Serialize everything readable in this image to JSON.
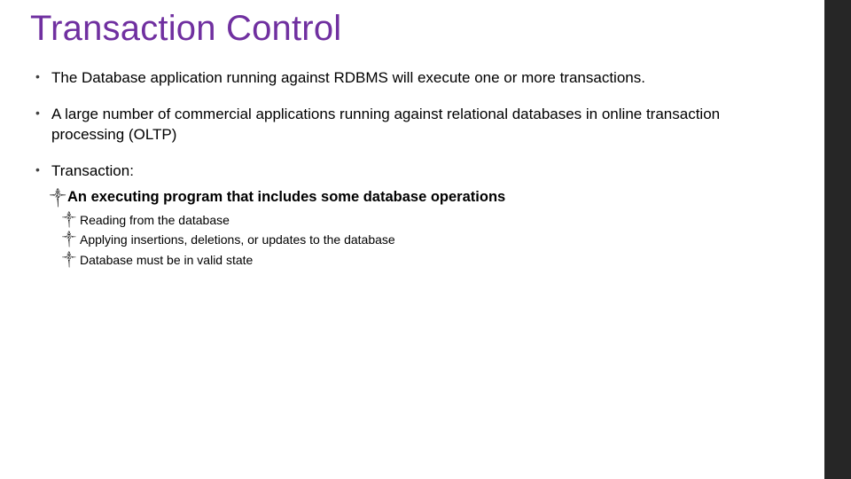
{
  "title": "Transaction Control",
  "bullets": [
    {
      "text": "The Database application running against RDBMS will execute one or more transactions."
    },
    {
      "text": "A large number of commercial applications running against relational databases in online transaction processing (OLTP)"
    },
    {
      "text": "Transaction:",
      "sub": {
        "text": "An executing program that includes some database operations",
        "sub": [
          "Reading from the database",
          "Applying insertions, deletions, or updates to the database",
          "Database must be in valid state"
        ]
      }
    }
  ],
  "deco_glyph": "༒"
}
